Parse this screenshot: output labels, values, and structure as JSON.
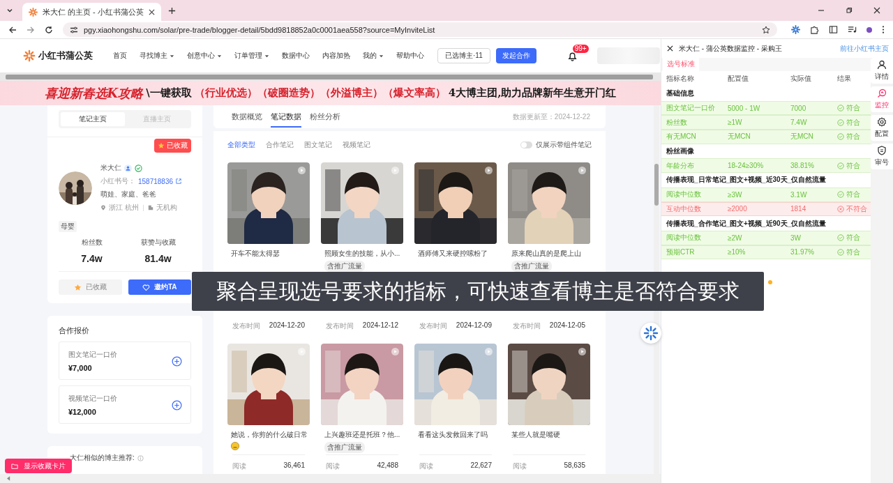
{
  "browser": {
    "tab_title": "米大仁 的主页 - 小红书蒲公英",
    "url": "pgy.xiaohongshu.com/solar/pre-trade/blogger-detail/5bdd9818852a0c0001aea558?source=MyInviteList"
  },
  "nav": {
    "logo": "小红书蒲公英",
    "items": [
      {
        "label": "首页",
        "dropdown": false
      },
      {
        "label": "寻找博主",
        "dropdown": true
      },
      {
        "label": "创意中心",
        "dropdown": true
      },
      {
        "label": "订单管理",
        "dropdown": true
      },
      {
        "label": "数据中心",
        "dropdown": false
      },
      {
        "label": "内容加热",
        "dropdown": false
      },
      {
        "label": "我的",
        "dropdown": true
      },
      {
        "label": "帮助中心",
        "dropdown": false
      }
    ],
    "selected_button": "已选博主·11",
    "primary_button": "发起合作",
    "notification_badge": "99+"
  },
  "banner": {
    "segments": [
      {
        "text": "喜迎新春选K攻略",
        "kind": "title"
      },
      {
        "text": "\\一键获取",
        "kind": "plain"
      },
      {
        "text": "（行业优选）（破圈造势）（外溢博主）（爆文率高）",
        "kind": "accent"
      },
      {
        "text": "4大博主团,助力品牌新年生意开门红",
        "kind": "plain"
      }
    ]
  },
  "profile": {
    "tabs": [
      {
        "label": "笔记主页",
        "selected": true
      },
      {
        "label": "直播主页",
        "selected": false
      }
    ],
    "favorite_badge": "已收藏",
    "name": "米大仁",
    "id_label": "小红书号：",
    "id": "158718836",
    "tags": "萌娃、家庭、爸爸",
    "location": "浙江 杭州",
    "organization": "无机构",
    "category": "母婴",
    "stats": [
      {
        "label": "粉丝数",
        "value": "7.4w"
      },
      {
        "label": "获赞与收藏",
        "value": "81.4w"
      }
    ],
    "collect_button": "已收藏",
    "invite_button": "邀约TA"
  },
  "pricing": {
    "title": "合作报价",
    "items": [
      {
        "label": "图文笔记一口价",
        "price": "¥7,000"
      },
      {
        "label": "视频笔记一口价",
        "price": "¥12,000"
      }
    ]
  },
  "similar": {
    "title": "大仁相似的博主推荐:"
  },
  "notes": {
    "tabs": [
      {
        "label": "数据概览",
        "selected": false
      },
      {
        "label": "笔记数据",
        "selected": true
      },
      {
        "label": "粉丝分析",
        "selected": false
      }
    ],
    "updated": "数据更新至：2024-12-22",
    "filters": [
      {
        "label": "全部类型",
        "selected": true
      },
      {
        "label": "合作笔记",
        "selected": false
      },
      {
        "label": "图文笔记",
        "selected": false
      },
      {
        "label": "视频笔记",
        "selected": false
      }
    ],
    "toggle": {
      "label": "仅展示带组件笔记",
      "on": false
    },
    "cards": [
      {
        "title": "开车不能太得瑟",
        "date_label": "发布时间",
        "date": "2024-12-20"
      },
      {
        "title": "照顾女生的技能，从小...",
        "tag": "含推广流量",
        "date_label": "发布时间",
        "date": "2024-12-12"
      },
      {
        "title": "酒师傅又来硬控嗦粉了",
        "date_label": "发布时间",
        "date": "2024-12-09"
      },
      {
        "title": "原来爬山真的是爬上山",
        "tag": "含推广流量",
        "date_label": "发布时间",
        "date": "2024-12-05"
      },
      {
        "title": "她说，你剪的什么破日常",
        "emoji": true,
        "stats": [
          {
            "label": "阅读",
            "value": "36,461"
          }
        ]
      },
      {
        "title": "上兴趣班还是托班？他...",
        "tag": "含推广流量",
        "stats": [
          {
            "label": "阅读",
            "value": "42,488"
          }
        ]
      },
      {
        "title": "看看这头发救回来了吗",
        "stats": [
          {
            "label": "阅读",
            "value": "22,627"
          }
        ]
      },
      {
        "title": "某些人就是嘴硬",
        "stats": [
          {
            "label": "阅读",
            "value": "58,635"
          }
        ]
      }
    ]
  },
  "panel": {
    "title": "米大仁 - 蒲公英数据监控 - 采购王",
    "link": "前往小红书主页",
    "tab": "选号标准",
    "columns": [
      "指标名称",
      "配置值",
      "实际值",
      "结果"
    ],
    "sections": [
      {
        "name": "基础信息",
        "rows": [
          {
            "metric": "图文笔记一口价",
            "config": "5000 - 1W",
            "actual": "7000",
            "result": "符合",
            "passed": true
          },
          {
            "metric": "粉丝数",
            "config": "≥1W",
            "actual": "7.4W",
            "result": "符合",
            "passed": true
          },
          {
            "metric": "有无MCN",
            "config": "无MCN",
            "actual": "无MCN",
            "result": "符合",
            "passed": true
          }
        ]
      },
      {
        "name": "粉丝画像",
        "rows": [
          {
            "metric": "年龄分布",
            "config": "18-24≥30%",
            "actual": "38.81%",
            "result": "符合",
            "passed": true
          }
        ]
      },
      {
        "name": "传播表现_日常笔记_图文+视频_近30天_仅自然流量",
        "rows": [
          {
            "metric": "阅读中位数",
            "config": "≥3W",
            "actual": "3.1W",
            "result": "符合",
            "passed": true
          },
          {
            "metric": "互动中位数",
            "config": "≥2000",
            "actual": "1814",
            "result": "不符合",
            "passed": false
          }
        ]
      },
      {
        "name": "传播表现_合作笔记_图文+视频_近90天_仅自然流量",
        "rows": [
          {
            "metric": "阅读中位数",
            "config": "≥2W",
            "actual": "3W",
            "result": "符合",
            "passed": true
          },
          {
            "metric": "预期CTR",
            "config": "≥10%",
            "actual": "31.97%",
            "result": "符合",
            "passed": true
          }
        ]
      }
    ],
    "rail": [
      {
        "label": "详情",
        "kind": "person",
        "selected": false
      },
      {
        "label": "监控",
        "kind": "monitor",
        "selected": true
      },
      {
        "label": "配置",
        "kind": "gear",
        "selected": false
      },
      {
        "label": "审号",
        "kind": "shield",
        "selected": false
      }
    ]
  },
  "caption": "聚合呈现选号要求的指标，可快速查看博主是否符合要求",
  "floating_button": "显示收藏卡片"
}
